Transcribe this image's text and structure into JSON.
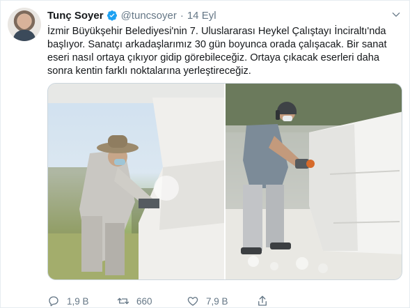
{
  "tweet": {
    "author_name": "Tunç Soyer",
    "handle": "@tuncsoyer",
    "separator": "·",
    "date": "14 Eyl",
    "text_lines": [
      "İzmir Büyükşehir Belediyesi'nin 7. Uluslararası Heykel Çalıştayı İnciraltı'nda",
      "başlıyor. Sanatçı arkadaşlarımız 30 gün boyunca orada çalışacak. Bir sanat",
      "eseri nasıl ortaya çıkıyor gidip görebileceğiz. Ortaya çıkacak eserleri daha",
      "sonra kentin farklı noktalarına yerleştireceğiz."
    ],
    "replies": "1,9 B",
    "retweets": "660",
    "likes": "7,9 B"
  },
  "icons": {
    "verified": "verified-badge-icon",
    "more": "chevron-down-icon",
    "reply": "reply-icon",
    "retweet": "retweet-icon",
    "like": "heart-icon",
    "share": "share-icon"
  },
  "colors": {
    "text": "#14171a",
    "muted": "#657786",
    "verified": "#1da1f2",
    "border": "#e6ecf0"
  }
}
